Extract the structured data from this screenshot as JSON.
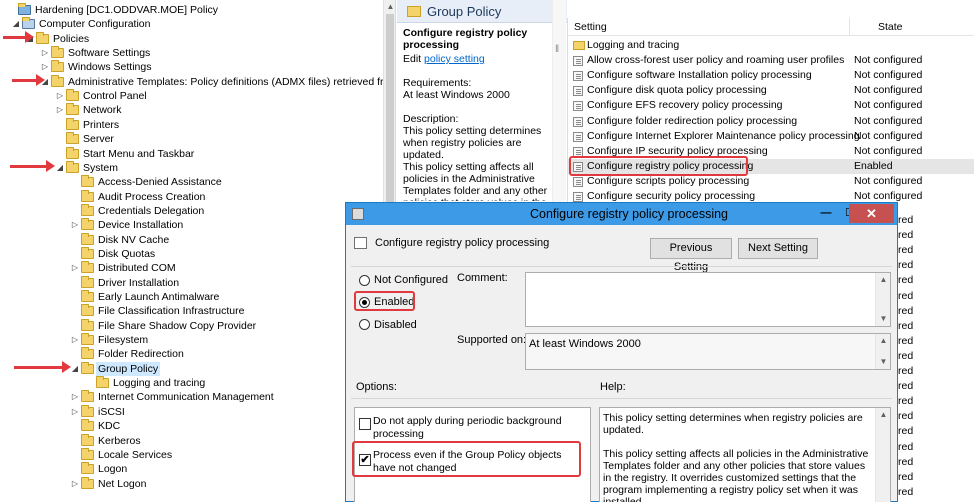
{
  "tree": {
    "nodes": [
      {
        "label": "Hardening [DC1.ODDVAR.MOE] Policy",
        "indent": 0,
        "exp": "",
        "selected": false
      },
      {
        "label": "Computer Configuration",
        "indent": 1,
        "exp": "◢",
        "selected": false
      },
      {
        "label": "Policies",
        "indent": 2,
        "exp": "◢",
        "selected": false
      },
      {
        "label": "Software Settings",
        "indent": 3,
        "exp": "▷",
        "selected": false
      },
      {
        "label": "Windows Settings",
        "indent": 3,
        "exp": "▷",
        "selected": false
      },
      {
        "label": "Administrative Templates: Policy definitions (ADMX files) retrieved from th",
        "indent": 3,
        "exp": "◢",
        "selected": false
      },
      {
        "label": "Control Panel",
        "indent": 4,
        "exp": "▷",
        "selected": false
      },
      {
        "label": "Network",
        "indent": 4,
        "exp": "▷",
        "selected": false
      },
      {
        "label": "Printers",
        "indent": 4,
        "exp": "",
        "selected": false
      },
      {
        "label": "Server",
        "indent": 4,
        "exp": "",
        "selected": false
      },
      {
        "label": "Start Menu and Taskbar",
        "indent": 4,
        "exp": "",
        "selected": false
      },
      {
        "label": "System",
        "indent": 4,
        "exp": "◢",
        "selected": false
      },
      {
        "label": "Access-Denied Assistance",
        "indent": 5,
        "exp": "",
        "selected": false
      },
      {
        "label": "Audit Process Creation",
        "indent": 5,
        "exp": "",
        "selected": false
      },
      {
        "label": "Credentials Delegation",
        "indent": 5,
        "exp": "",
        "selected": false
      },
      {
        "label": "Device Installation",
        "indent": 5,
        "exp": "▷",
        "selected": false
      },
      {
        "label": "Disk NV Cache",
        "indent": 5,
        "exp": "",
        "selected": false
      },
      {
        "label": "Disk Quotas",
        "indent": 5,
        "exp": "",
        "selected": false
      },
      {
        "label": "Distributed COM",
        "indent": 5,
        "exp": "▷",
        "selected": false
      },
      {
        "label": "Driver Installation",
        "indent": 5,
        "exp": "",
        "selected": false
      },
      {
        "label": "Early Launch Antimalware",
        "indent": 5,
        "exp": "",
        "selected": false
      },
      {
        "label": "File Classification Infrastructure",
        "indent": 5,
        "exp": "",
        "selected": false
      },
      {
        "label": "File Share Shadow Copy Provider",
        "indent": 5,
        "exp": "",
        "selected": false
      },
      {
        "label": "Filesystem",
        "indent": 5,
        "exp": "▷",
        "selected": false
      },
      {
        "label": "Folder Redirection",
        "indent": 5,
        "exp": "",
        "selected": false
      },
      {
        "label": "Group Policy",
        "indent": 5,
        "exp": "◢",
        "selected": true
      },
      {
        "label": "Logging and tracing",
        "indent": 6,
        "exp": "",
        "selected": false
      },
      {
        "label": "Internet Communication Management",
        "indent": 5,
        "exp": "▷",
        "selected": false
      },
      {
        "label": "iSCSI",
        "indent": 5,
        "exp": "▷",
        "selected": false
      },
      {
        "label": "KDC",
        "indent": 5,
        "exp": "",
        "selected": false
      },
      {
        "label": "Kerberos",
        "indent": 5,
        "exp": "",
        "selected": false
      },
      {
        "label": "Locale Services",
        "indent": 5,
        "exp": "",
        "selected": false
      },
      {
        "label": "Logon",
        "indent": 5,
        "exp": "",
        "selected": false
      },
      {
        "label": "Net Logon",
        "indent": 5,
        "exp": "▷",
        "selected": false
      }
    ]
  },
  "desc": {
    "header": "Group Policy",
    "title": "Configure registry policy processing",
    "edit_prefix": "Edit ",
    "edit_link": "policy setting ",
    "req_label": "Requirements:",
    "req_value": "At least Windows 2000",
    "desc_label": "Description:",
    "p1": "This policy setting determines when registry policies are updated.",
    "p2": "This policy setting affects all policies in the Administrative Templates folder and any other policies that store values in the"
  },
  "list": {
    "col_setting": "Setting",
    "col_state": "State",
    "rows": [
      {
        "name": "Logging and tracing",
        "state": "",
        "folder": true,
        "selected": false
      },
      {
        "name": "Allow cross-forest user policy and roaming user profiles",
        "state": "Not configured",
        "folder": false,
        "selected": false
      },
      {
        "name": "Configure software Installation policy processing",
        "state": "Not configured",
        "folder": false,
        "selected": false
      },
      {
        "name": "Configure disk quota policy processing",
        "state": "Not configured",
        "folder": false,
        "selected": false
      },
      {
        "name": "Configure EFS recovery policy processing",
        "state": "Not configured",
        "folder": false,
        "selected": false
      },
      {
        "name": "Configure folder redirection policy processing",
        "state": "Not configured",
        "folder": false,
        "selected": false
      },
      {
        "name": "Configure Internet Explorer Maintenance policy processing",
        "state": "Not configured",
        "folder": false,
        "selected": false
      },
      {
        "name": "Configure IP security policy processing",
        "state": "Not configured",
        "folder": false,
        "selected": false
      },
      {
        "name": "Configure registry policy processing",
        "state": "Enabled",
        "folder": false,
        "selected": true
      },
      {
        "name": "Configure scripts policy processing",
        "state": "Not configured",
        "folder": false,
        "selected": false
      },
      {
        "name": "Configure security policy processing",
        "state": "Not configured",
        "folder": false,
        "selected": false
      }
    ],
    "tail_states": [
      "red",
      "red",
      "red",
      "red",
      "red",
      "red",
      "red",
      "red",
      "red",
      "red",
      "red",
      "red",
      "red",
      "red",
      "red",
      "red",
      "red",
      "red",
      "red",
      "red"
    ]
  },
  "dialog": {
    "title": "Configure registry policy processing",
    "minimize": "—",
    "maximize": "☐",
    "close": "✕",
    "subtitle": "Configure registry policy processing",
    "prev_button": "Previous Setting",
    "next_button": "Next Setting",
    "radio_not_configured": "Not Configured",
    "radio_enabled": "Enabled",
    "radio_disabled": "Disabled",
    "comment_label": "Comment:",
    "supported_label": "Supported on:",
    "supported_value": "At least Windows 2000",
    "options_label": "Options:",
    "help_label": "Help:",
    "opt1": "Do not apply during periodic background processing",
    "opt2": "Process even if the Group Policy objects have not changed",
    "help_p1": "This policy setting determines when registry policies are updated.",
    "help_p2": "This policy setting affects all policies in the Administrative Templates folder and any other policies that store values in the registry. It overrides customized settings that the program implementing a registry policy set when it was installed."
  },
  "colors": {
    "highlight": "#e0393e",
    "titlebar": "#3c9ae6",
    "selection": "#cde8ff"
  }
}
